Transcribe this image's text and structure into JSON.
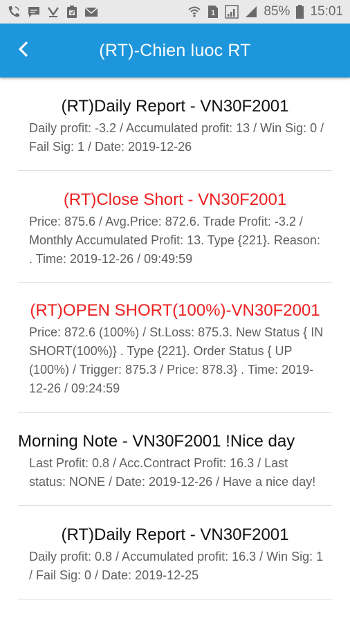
{
  "status_bar": {
    "battery": "85%",
    "time": "15:01",
    "left_icons": [
      "phone-call-icon",
      "message-icon",
      "download-icon",
      "clipboard-icon",
      "mail-icon"
    ],
    "right_icons": [
      "wifi-icon",
      "sim-icon",
      "signal-icon"
    ]
  },
  "header": {
    "title": "(RT)-Chien luoc RT",
    "back_icon": "chevron-left-icon",
    "background": "#1e96dc"
  },
  "colors": {
    "alert_title": "#ee2020",
    "body_text": "#5f5f5f"
  },
  "messages": [
    {
      "title": "(RT)Daily Report - VN30F2001",
      "body": "Daily profit: -3.2 / Accumulated profit: 13 / Win Sig: 0 / Fail Sig: 1 / Date: 2019-12-26"
    },
    {
      "title": "(RT)Close Short - VN30F2001",
      "body": "Price: 875.6 / Avg.Price: 872.6. Trade Profit: -3.2 / Monthly Accumulated Profit: 13. Type {221}. Reason: . Time: 2019-12-26 / 09:49:59"
    },
    {
      "title": "(RT)OPEN SHORT(100%)-VN30F2001",
      "body": "Price: 872.6 (100%) / St.Loss: 875.3. New Status { IN SHORT(100%)} . Type {221}. Order Status { UP (100%) / Trigger: 875.3 / Price: 878.3} . Time: 2019-12-26 / 09:24:59"
    },
    {
      "title": "Morning Note - VN30F2001 !Nice day",
      "body": "Last Profit: 0.8 / Acc.Contract Profit: 16.3 / Last status: NONE / Date: 2019-12-26 / Have a nice day!"
    },
    {
      "title": "(RT)Daily Report - VN30F2001",
      "body": "Daily profit: 0.8 / Accumulated profit: 16.3 / Win Sig: 1 / Fail Sig: 0 / Date: 2019-12-25"
    }
  ]
}
